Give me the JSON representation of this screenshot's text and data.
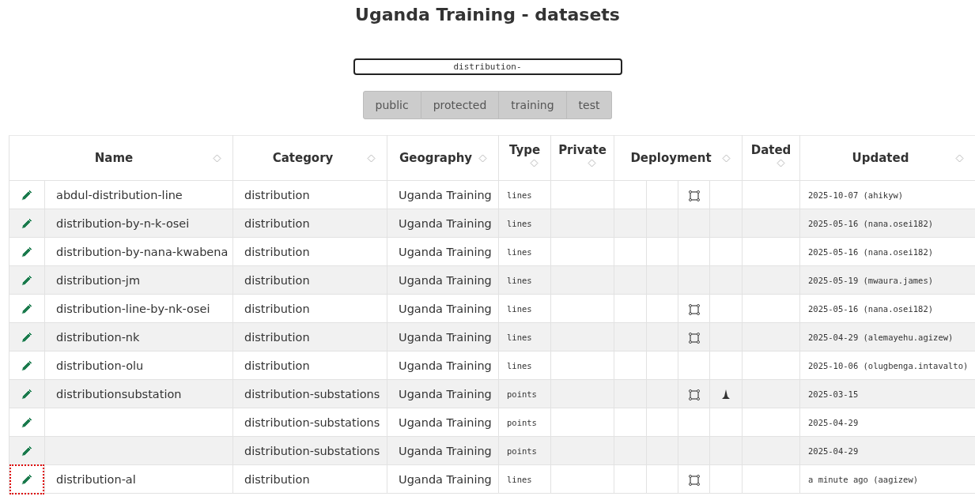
{
  "title": "Uganda Training - datasets",
  "search": {
    "value": "distribution-"
  },
  "filters": [
    {
      "label": "public",
      "selected": false
    },
    {
      "label": "protected",
      "selected": false
    },
    {
      "label": "training",
      "selected": false
    },
    {
      "label": "test",
      "selected": false
    }
  ],
  "columns": [
    {
      "label": "Name",
      "kind": "side"
    },
    {
      "label": "Category",
      "kind": "side"
    },
    {
      "label": "Geography",
      "kind": "side"
    },
    {
      "label": "Type",
      "kind": "below"
    },
    {
      "label": "Private",
      "kind": "below"
    },
    {
      "label": "Deployment",
      "kind": "side"
    },
    {
      "label": "Dated",
      "kind": "below"
    },
    {
      "label": "Updated",
      "kind": "side"
    }
  ],
  "rows": [
    {
      "name": "abdul-distribution-line",
      "category": "distribution",
      "geography": "Uganda Training",
      "type": "lines",
      "boundary": true,
      "peak": false,
      "updated": "2025-10-07 (ahikyw)",
      "focused": false
    },
    {
      "name": "distribution-by-n-k-osei",
      "category": "distribution",
      "geography": "Uganda Training",
      "type": "lines",
      "boundary": false,
      "peak": false,
      "updated": "2025-05-16 (nana.osei182)",
      "focused": false
    },
    {
      "name": "distribution-by-nana-kwabena",
      "category": "distribution",
      "geography": "Uganda Training",
      "type": "lines",
      "boundary": false,
      "peak": false,
      "updated": "2025-05-16 (nana.osei182)",
      "focused": false
    },
    {
      "name": "distribution-jm",
      "category": "distribution",
      "geography": "Uganda Training",
      "type": "lines",
      "boundary": false,
      "peak": false,
      "updated": "2025-05-19 (mwaura.james)",
      "focused": false
    },
    {
      "name": "distribution-line-by-nk-osei",
      "category": "distribution",
      "geography": "Uganda Training",
      "type": "lines",
      "boundary": true,
      "peak": false,
      "updated": "2025-05-16 (nana.osei182)",
      "focused": false
    },
    {
      "name": "distribution-nk",
      "category": "distribution",
      "geography": "Uganda Training",
      "type": "lines",
      "boundary": true,
      "peak": false,
      "updated": "2025-04-29 (alemayehu.agizew)",
      "focused": false
    },
    {
      "name": "distribution-olu",
      "category": "distribution",
      "geography": "Uganda Training",
      "type": "lines",
      "boundary": false,
      "peak": false,
      "updated": "2025-10-06 (olugbenga.intavalto)",
      "focused": false
    },
    {
      "name": "distributionsubstation",
      "category": "distribution-substations",
      "geography": "Uganda Training",
      "type": "points",
      "boundary": true,
      "peak": true,
      "updated": "2025-03-15",
      "focused": false
    },
    {
      "category": "distribution-substations",
      "geography": "Uganda Training",
      "type": "points",
      "boundary": false,
      "peak": false,
      "updated": "2025-04-29",
      "focused": false
    },
    {
      "category": "distribution-substations",
      "geography": "Uganda Training",
      "type": "points",
      "boundary": false,
      "peak": false,
      "updated": "2025-04-29",
      "focused": false
    },
    {
      "name": "distribution-al",
      "category": "distribution",
      "geography": "Uganda Training",
      "type": "lines",
      "boundary": true,
      "peak": false,
      "updated": "a minute ago (aagizew)",
      "focused": true
    }
  ]
}
